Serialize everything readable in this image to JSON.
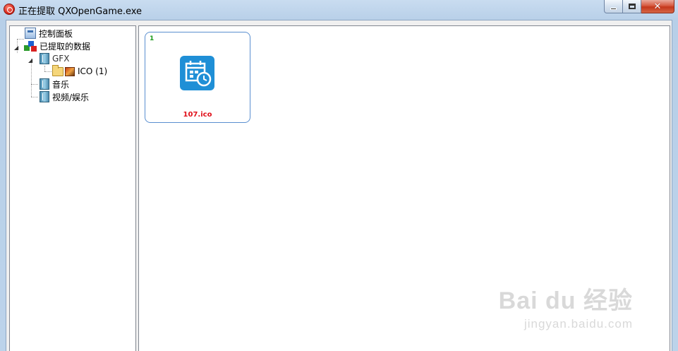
{
  "window": {
    "title": "正在提取 QXOpenGame.exe",
    "colors": {
      "titlebar": "#c9dcf0",
      "close_button": "#c4371b"
    }
  },
  "tree": {
    "items": [
      {
        "label": "控制面板",
        "icon": "control-panel-icon"
      },
      {
        "label": "已提取的数据",
        "icon": "extracted-data-icon",
        "expanded": true
      },
      {
        "label": "GFX",
        "icon": "book-icon",
        "expanded": true
      },
      {
        "label": "ICO (1)",
        "icon": "folder-image-icon"
      },
      {
        "label": "音乐",
        "icon": "music-icon"
      },
      {
        "label": "视频/娱乐",
        "icon": "video-icon"
      }
    ]
  },
  "content": {
    "thumbnails": [
      {
        "index": "1",
        "filename": "107.ico",
        "icon": "calendar-clock-icon",
        "accent": "#1f8fd6"
      }
    ]
  },
  "watermark": {
    "brand": "Bai du 经验",
    "url": "jingyan.baidu.com"
  }
}
